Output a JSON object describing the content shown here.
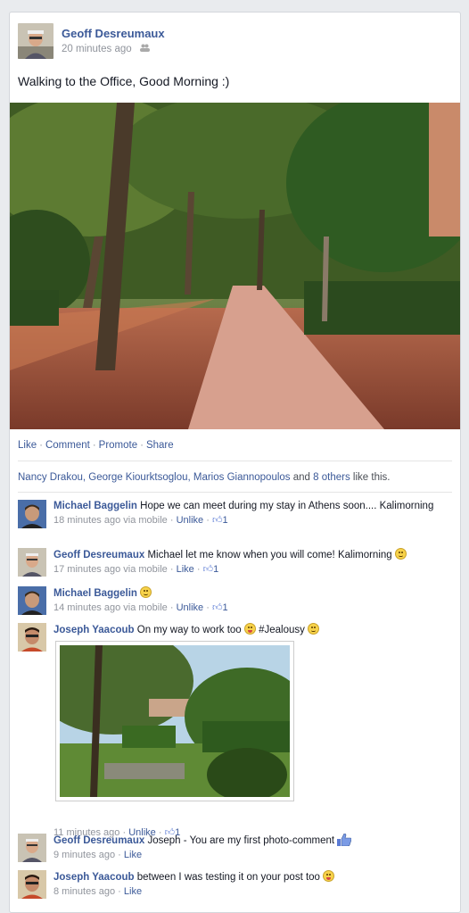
{
  "post": {
    "author": "Geoff Desreumaux",
    "time": "20 minutes ago",
    "status": "Walking to the Office, Good Morning :)",
    "actions": [
      "Like",
      "Comment",
      "Promote",
      "Share"
    ],
    "likes": {
      "names": "Nancy Drakou, George Kiourktsoglou, Marios Giannopoulos",
      "and": "and",
      "others": "8 others",
      "suffix": "like this."
    }
  },
  "comments": [
    {
      "author": "Michael Baggelin",
      "text": "Hope we can meet during my stay in Athens soon.... Kalimorning",
      "time": "18 minutes ago via mobile",
      "action": "Unlike",
      "like_count": "1"
    },
    {
      "author": "Geoff Desreumaux",
      "text": "Michael let me know when you will come! Kalimorning",
      "time": "17 minutes ago via mobile",
      "action": "Like",
      "like_count": "1"
    },
    {
      "author": "Michael Baggelin",
      "text": "",
      "time": "14 minutes ago via mobile",
      "action": "Unlike",
      "like_count": "1"
    },
    {
      "author": "Joseph Yaacoub",
      "text": "On my way to work too",
      "text2": "#Jealousy",
      "time": "11 minutes ago",
      "action": "Unlike",
      "like_count": "1"
    },
    {
      "author": "Geoff Desreumaux",
      "text": "Joseph - You are my first photo-comment",
      "time": "9 minutes ago",
      "action": "Like"
    },
    {
      "author": "Joseph Yaacoub",
      "text": "between I was testing it on your post too",
      "time": "8 minutes ago",
      "action": "Like"
    }
  ],
  "separator": "·",
  "colors": {
    "link": "#3b5998",
    "meta": "#90949c"
  }
}
